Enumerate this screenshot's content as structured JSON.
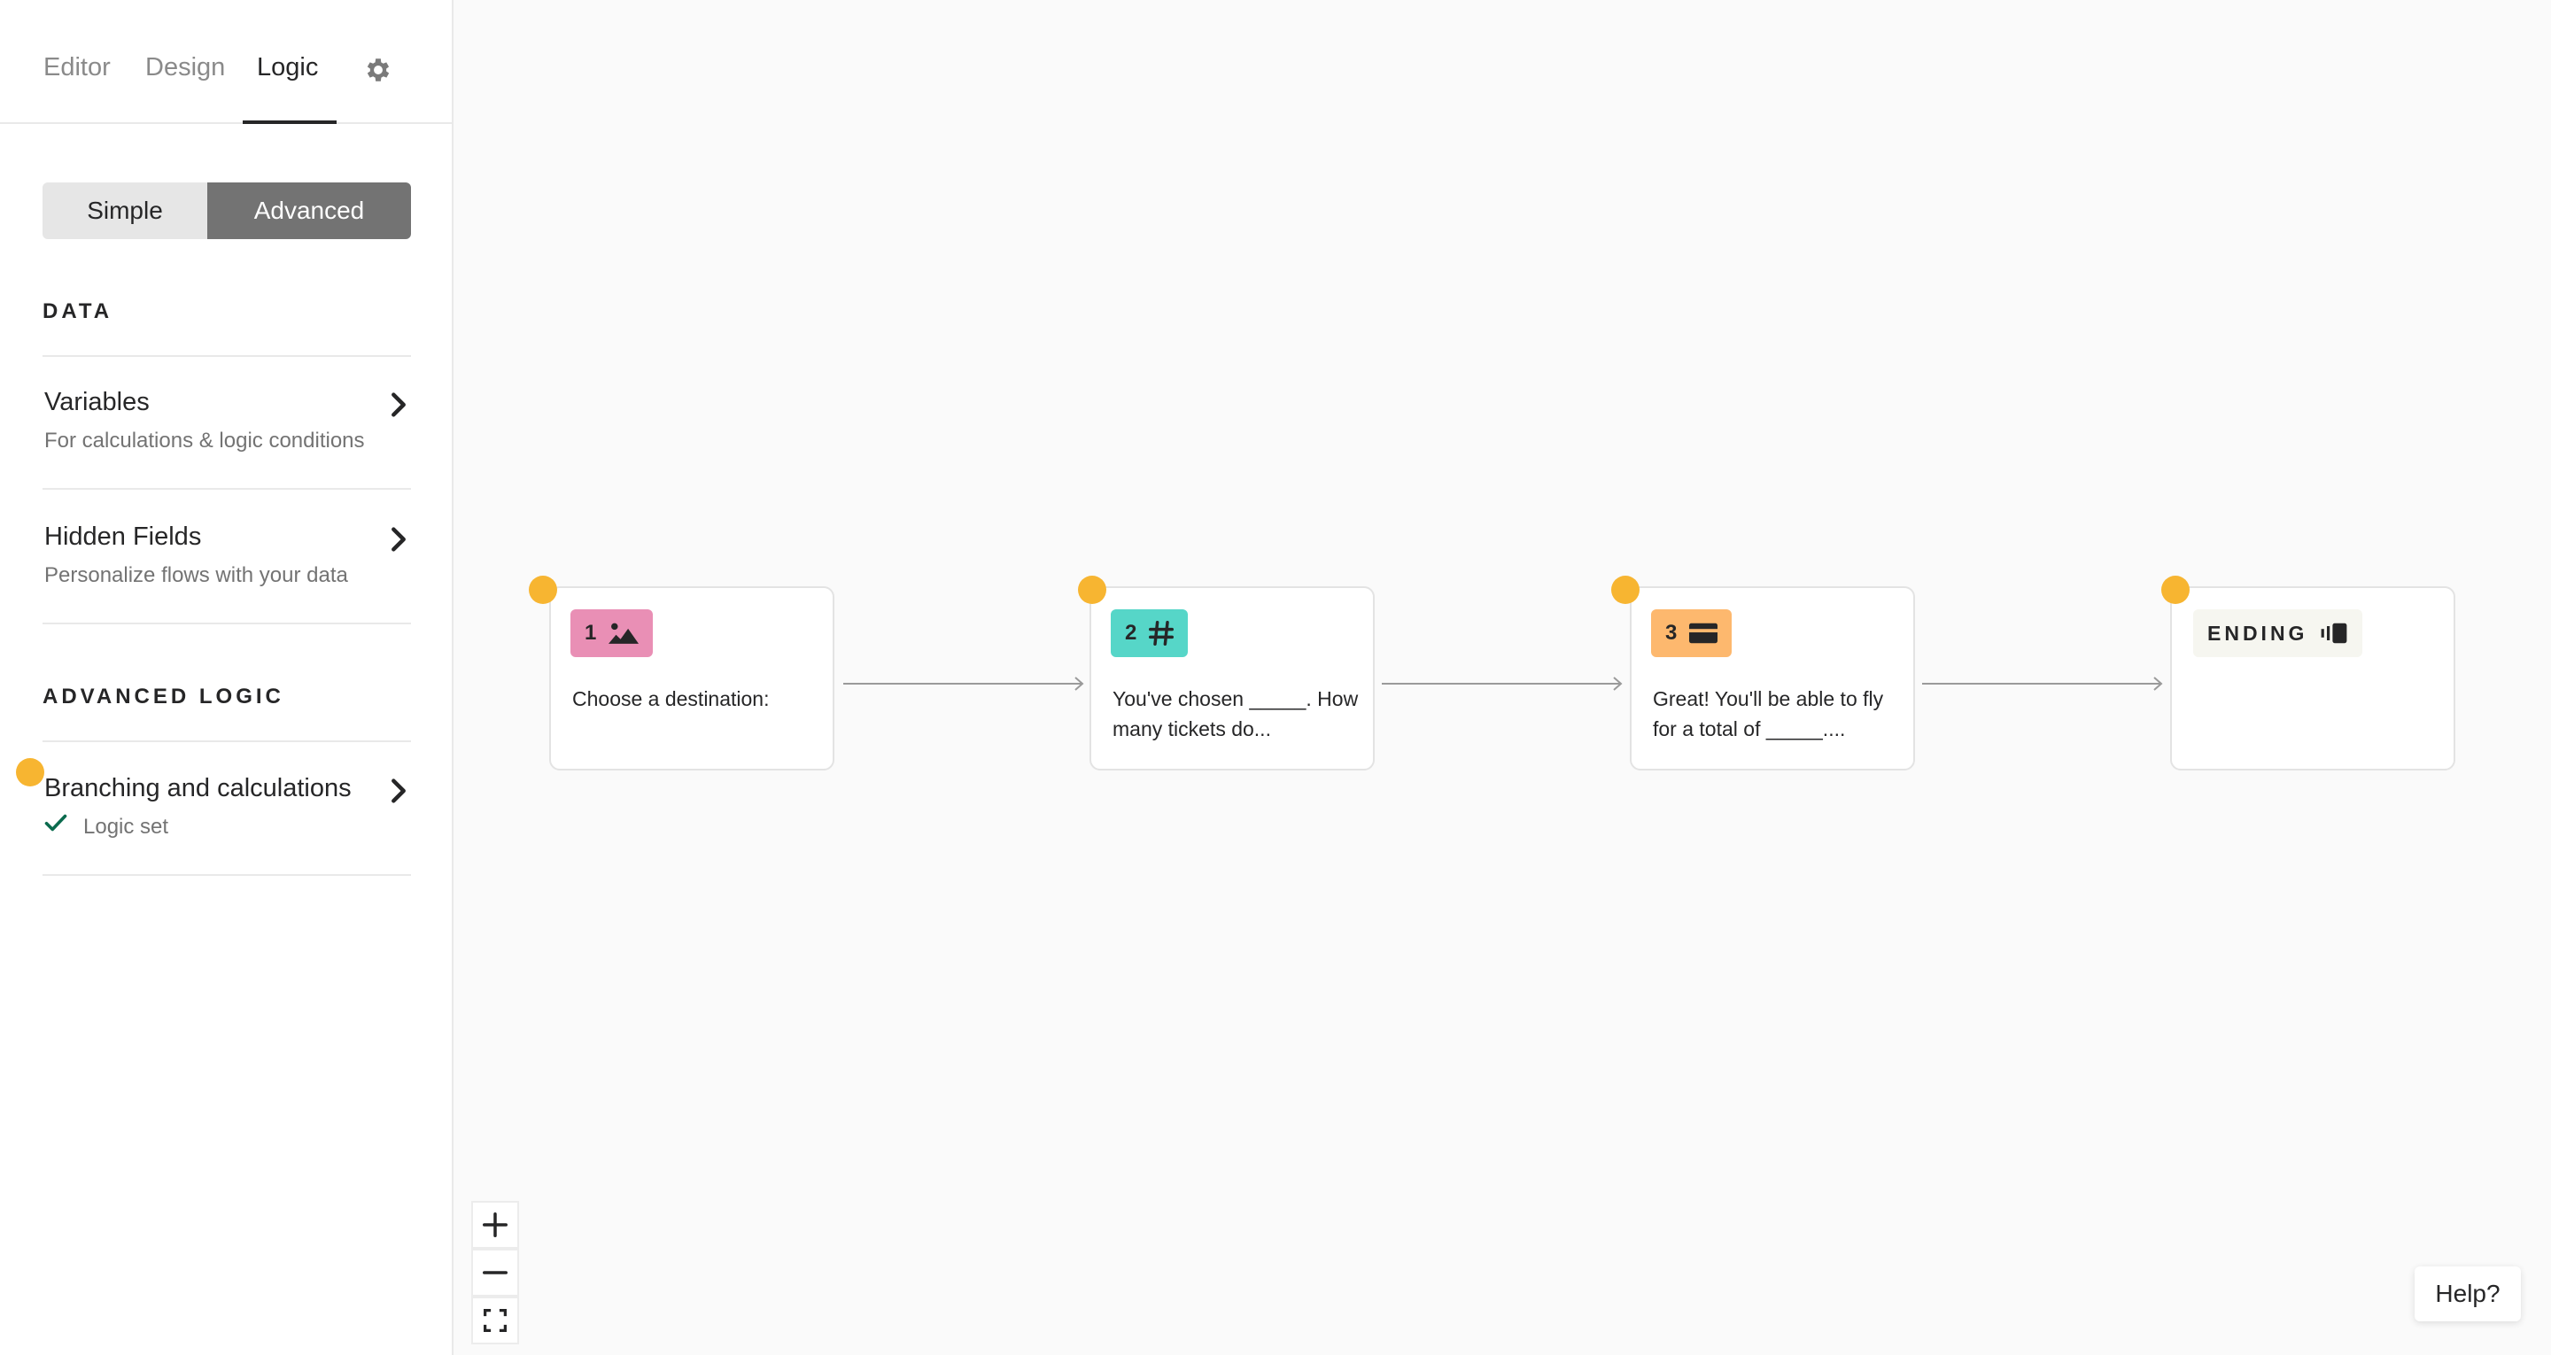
{
  "tabs": [
    {
      "label": "Editor"
    },
    {
      "label": "Design"
    },
    {
      "label": "Logic"
    }
  ],
  "active_tab": "Logic",
  "mode_toggle": {
    "simple": "Simple",
    "advanced": "Advanced",
    "selected": "Advanced"
  },
  "sections": {
    "data": "DATA",
    "advanced_logic": "ADVANCED LOGIC"
  },
  "items": {
    "variables": {
      "title": "Variables",
      "subtitle": "For calculations & logic conditions"
    },
    "hidden_fields": {
      "title": "Hidden Fields",
      "subtitle": "Personalize flows with your data"
    },
    "branching": {
      "title": "Branching and calculations",
      "subtitle": "Logic set"
    }
  },
  "nodes": [
    {
      "number": "1",
      "icon": "picture-choice-icon",
      "color": "#e98fb5",
      "text": "Choose a destination:"
    },
    {
      "number": "2",
      "icon": "number-hash-icon",
      "color": "#56d6c8",
      "text": "You've chosen _____. How many tickets do..."
    },
    {
      "number": "3",
      "icon": "payment-card-icon",
      "color": "#fdb86e",
      "text": "Great! You'll be able to fly for a total of _____...."
    },
    {
      "label": "ENDING",
      "icon": "ending-icon",
      "color": "#f6f6f0"
    }
  ],
  "colors": {
    "accent_dot": "#f7b531",
    "toggle_active": "#737373"
  },
  "help": {
    "label": "Help?"
  }
}
